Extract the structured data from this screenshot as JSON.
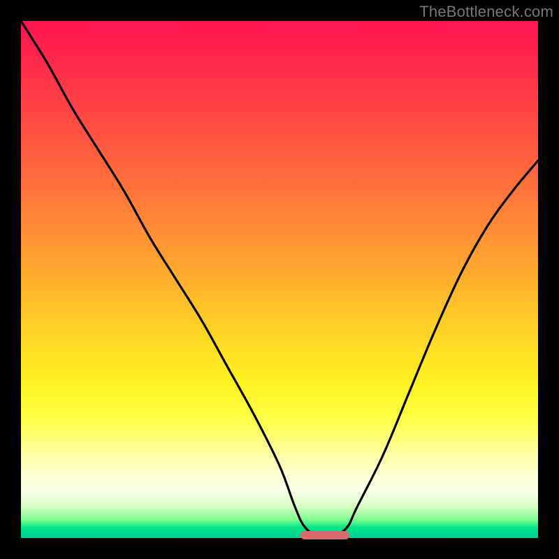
{
  "watermark": "TheBottleneck.com",
  "colors": {
    "background": "#000000",
    "curve": "#000000",
    "marker": "#d86b6b"
  },
  "chart_data": {
    "type": "line",
    "title": "",
    "xlabel": "",
    "ylabel": "",
    "xlim": [
      0,
      100
    ],
    "ylim": [
      0,
      100
    ],
    "grid": false,
    "series": [
      {
        "name": "bottleneck-curve",
        "x": [
          0,
          5,
          10,
          15,
          20,
          25,
          30,
          35,
          40,
          45,
          50,
          53,
          55,
          58,
          60,
          63,
          65,
          70,
          75,
          80,
          85,
          90,
          95,
          100
        ],
        "y": [
          100,
          92,
          83,
          75,
          67,
          58,
          50,
          42,
          33,
          24,
          14,
          6,
          2,
          0,
          0,
          2,
          6,
          16,
          28,
          40,
          51,
          60,
          67,
          73
        ]
      }
    ],
    "marker": {
      "x": 58.8,
      "y": 0.5,
      "width_pct": 9.5,
      "height_pct": 1.6
    }
  }
}
